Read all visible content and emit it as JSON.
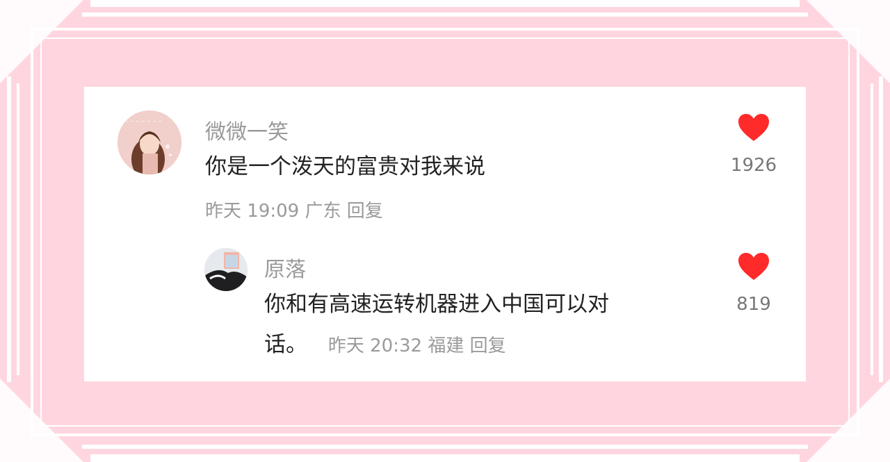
{
  "comments": [
    {
      "author": "微微一笑",
      "text": "你是一个泼天的富贵对我来说",
      "date": "昨天",
      "time": "19:09",
      "location": "广东",
      "reply_label": "回复",
      "likes": "1926",
      "avatar_icon": "girl-avatar"
    },
    {
      "author": "原落",
      "text_line1": "你和有高速运转机器进入中国可以对",
      "text_line2": "话。",
      "date": "昨天",
      "time": "20:32",
      "location": "福建",
      "reply_label": "回复",
      "likes": "819",
      "avatar_icon": "photo-avatar"
    }
  ],
  "colors": {
    "background": "#ffd6df",
    "card": "#ffffff",
    "heart": "#ff2a2a",
    "muted_text": "#9a9a9a",
    "main_text": "#222222"
  },
  "icons": {
    "like": "heart-icon"
  }
}
